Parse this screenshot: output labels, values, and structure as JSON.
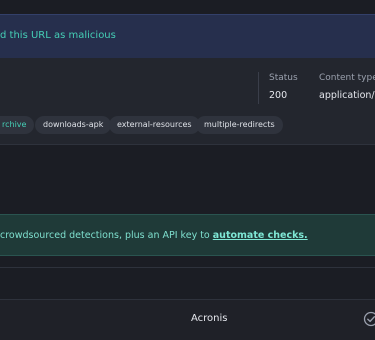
{
  "alert": {
    "text": "d this URL as malicious"
  },
  "http_meta": {
    "status_label": "Status",
    "status_value": "200",
    "content_type_label": "Content type",
    "content_type_value": "application/v"
  },
  "tags": [
    {
      "label": "rchive"
    },
    {
      "label": "downloads-apk"
    },
    {
      "label": "external-resources"
    },
    {
      "label": "multiple-redirects"
    }
  ],
  "promo": {
    "text": "crowdsourced detections, plus an API key to ",
    "link": "automate checks."
  },
  "vendors": [
    {
      "name": "Acronis",
      "status_icon": "check-circle-icon"
    }
  ],
  "colors": {
    "accent": "#45cfb6",
    "alert_bg": "#262f4d",
    "promo_bg": "#1f3a38",
    "page_bg": "#1b1d24"
  }
}
